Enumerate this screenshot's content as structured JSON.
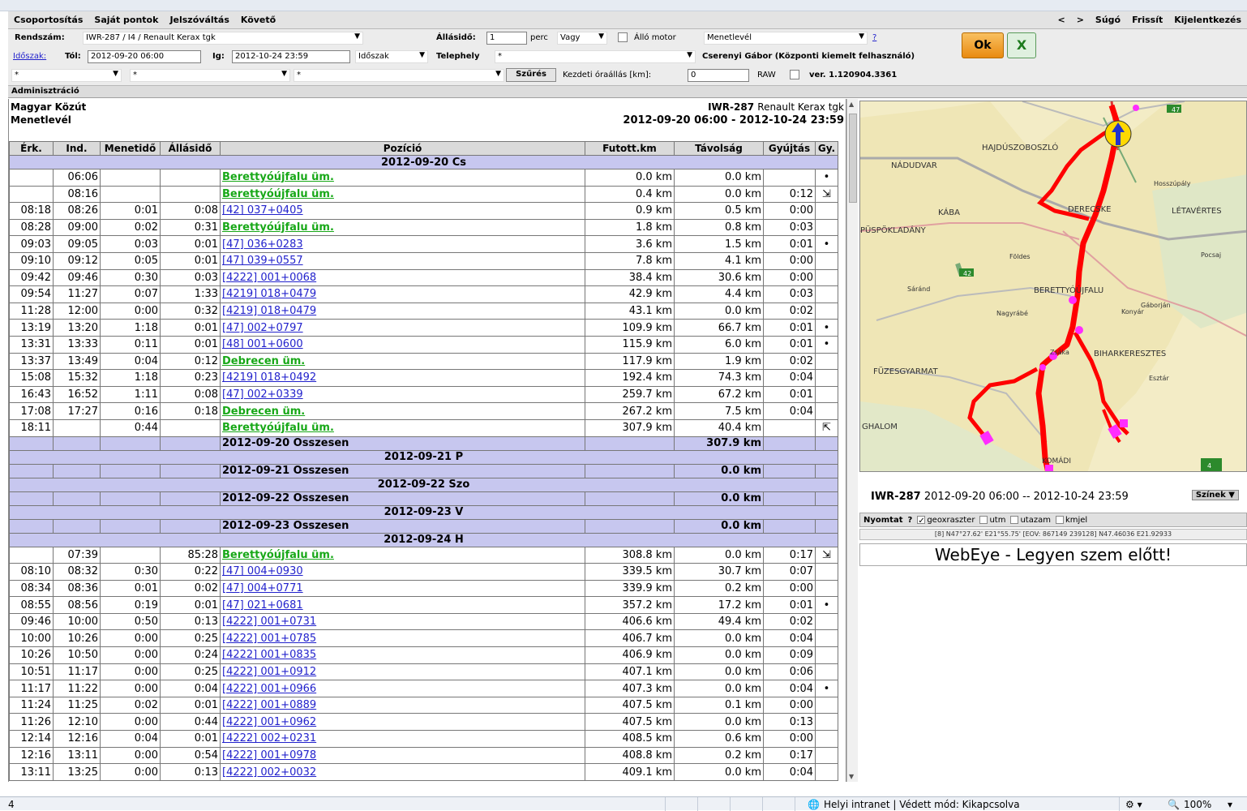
{
  "menu": {
    "items": [
      "Csoportosítás",
      "Saját pontok",
      "Jelszóváltás",
      "Követő"
    ],
    "right": [
      "<",
      ">",
      "Súgó",
      "Frissít",
      "Kijelentkezés"
    ]
  },
  "filter": {
    "rendszam_label": "Rendszám:",
    "rendszam_value": "IWR-287 / I4 / Renault Kerax tgk",
    "allasido_label": "Állásidő:",
    "allasido_value": "1",
    "perc": "perc",
    "vagy": "Vagy",
    "allo_motor": "Álló motor",
    "report_type": "Menetlevél",
    "help_q": "?",
    "idoszak_link": "Időszak:",
    "tol_label": "Tól:",
    "tol_value": "2012-09-20 06:00",
    "ig_label": "Ig:",
    "ig_value": "2012-10-24 23:59",
    "idoszak_combo": "Időszak",
    "telephely_label": "Telephely",
    "telephely_value": "*",
    "user": "Cserenyi Gábor (Központi kiemelt felhasználó)",
    "combo1": "*",
    "combo2": "*",
    "combo3": "*",
    "szures": "Szűrés",
    "kezdeti_label": "Kezdeti óraállás [km]:",
    "kezdeti_value": "0",
    "raw": "RAW",
    "version": "ver. 1.120904.3361",
    "ok": "Ok",
    "excel": "X"
  },
  "section": "Adminisztráció",
  "report": {
    "company": "Magyar Közút",
    "doc": "Menetlevél",
    "vehicle_id": "IWR-287",
    "vehicle_name": "Renault Kerax tgk",
    "period": "2012-09-20 06:00 - 2012-10-24 23:59",
    "columns": [
      "Érk.",
      "Ind.",
      "Menetidő",
      "Állásidő",
      "Pozíció",
      "Futott.km",
      "Távolság",
      "Gyújtás",
      "Gy."
    ],
    "rows": [
      {
        "t": "day",
        "label": "2012-09-20 Cs"
      },
      {
        "t": "r",
        "erk": "",
        "ind": "06:06",
        "menet": "",
        "allas": "",
        "pos": "Berettyóújfalu üm.",
        "g": true,
        "futott": "0.0 km",
        "tav": "0.0 km",
        "gyuj": "",
        "gy": "•"
      },
      {
        "t": "r",
        "erk": "",
        "ind": "08:16",
        "menet": "",
        "allas": "",
        "pos": "Berettyóújfalu üm.",
        "g": true,
        "futott": "0.4 km",
        "tav": "0.0 km",
        "gyuj": "0:12",
        "gy": "⇲"
      },
      {
        "t": "r",
        "erk": "08:18",
        "ind": "08:26",
        "menet": "0:01",
        "allas": "0:08",
        "pos": "[42] 037+0405",
        "g": false,
        "futott": "0.9 km",
        "tav": "0.5 km",
        "gyuj": "0:00",
        "gy": ""
      },
      {
        "t": "r",
        "erk": "08:28",
        "ind": "09:00",
        "menet": "0:02",
        "allas": "0:31",
        "pos": "Berettyóújfalu üm.",
        "g": true,
        "futott": "1.8 km",
        "tav": "0.8 km",
        "gyuj": "0:03",
        "gy": ""
      },
      {
        "t": "r",
        "erk": "09:03",
        "ind": "09:05",
        "menet": "0:03",
        "allas": "0:01",
        "pos": "[47] 036+0283",
        "g": false,
        "futott": "3.6 km",
        "tav": "1.5 km",
        "gyuj": "0:01",
        "gy": "•"
      },
      {
        "t": "r",
        "erk": "09:10",
        "ind": "09:12",
        "menet": "0:05",
        "allas": "0:01",
        "pos": "[47] 039+0557",
        "g": false,
        "futott": "7.8 km",
        "tav": "4.1 km",
        "gyuj": "0:00",
        "gy": ""
      },
      {
        "t": "r",
        "erk": "09:42",
        "ind": "09:46",
        "menet": "0:30",
        "allas": "0:03",
        "pos": "[4222] 001+0068",
        "g": false,
        "futott": "38.4 km",
        "tav": "30.6 km",
        "gyuj": "0:00",
        "gy": ""
      },
      {
        "t": "r",
        "erk": "09:54",
        "ind": "11:27",
        "menet": "0:07",
        "allas": "1:33",
        "pos": "[4219] 018+0479",
        "g": false,
        "futott": "42.9 km",
        "tav": "4.4 km",
        "gyuj": "0:03",
        "gy": ""
      },
      {
        "t": "r",
        "erk": "11:28",
        "ind": "12:00",
        "menet": "0:00",
        "allas": "0:32",
        "pos": "[4219] 018+0479",
        "g": false,
        "futott": "43.1 km",
        "tav": "0.0 km",
        "gyuj": "0:02",
        "gy": ""
      },
      {
        "t": "r",
        "erk": "13:19",
        "ind": "13:20",
        "menet": "1:18",
        "allas": "0:01",
        "pos": "[47] 002+0797",
        "g": false,
        "futott": "109.9 km",
        "tav": "66.7 km",
        "gyuj": "0:01",
        "gy": "•"
      },
      {
        "t": "r",
        "erk": "13:31",
        "ind": "13:33",
        "menet": "0:11",
        "allas": "0:01",
        "pos": "[48] 001+0600",
        "g": false,
        "futott": "115.9 km",
        "tav": "6.0 km",
        "gyuj": "0:01",
        "gy": "•"
      },
      {
        "t": "r",
        "erk": "13:37",
        "ind": "13:49",
        "menet": "0:04",
        "allas": "0:12",
        "pos": "Debrecen üm.",
        "g": true,
        "futott": "117.9 km",
        "tav": "1.9 km",
        "gyuj": "0:02",
        "gy": ""
      },
      {
        "t": "r",
        "erk": "15:08",
        "ind": "15:32",
        "menet": "1:18",
        "allas": "0:23",
        "pos": "[4219] 018+0492",
        "g": false,
        "futott": "192.4 km",
        "tav": "74.3 km",
        "gyuj": "0:04",
        "gy": ""
      },
      {
        "t": "r",
        "erk": "16:43",
        "ind": "16:52",
        "menet": "1:11",
        "allas": "0:08",
        "pos": "[47] 002+0339",
        "g": false,
        "futott": "259.7 km",
        "tav": "67.2 km",
        "gyuj": "0:01",
        "gy": ""
      },
      {
        "t": "r",
        "erk": "17:08",
        "ind": "17:27",
        "menet": "0:16",
        "allas": "0:18",
        "pos": "Debrecen üm.",
        "g": true,
        "futott": "267.2 km",
        "tav": "7.5 km",
        "gyuj": "0:04",
        "gy": ""
      },
      {
        "t": "r",
        "erk": "18:11",
        "ind": "",
        "menet": "0:44",
        "allas": "",
        "pos": "Berettyóújfalu üm.",
        "g": true,
        "futott": "307.9 km",
        "tav": "40.4 km",
        "gyuj": "",
        "gy": "⇱"
      },
      {
        "t": "sum",
        "label": "2012-09-20 Összesen",
        "total": "307.9 km"
      },
      {
        "t": "day",
        "label": "2012-09-21 P"
      },
      {
        "t": "sum",
        "label": "2012-09-21 Összesen",
        "total": "0.0 km"
      },
      {
        "t": "day",
        "label": "2012-09-22 Szo"
      },
      {
        "t": "sum",
        "label": "2012-09-22 Összesen",
        "total": "0.0 km"
      },
      {
        "t": "day",
        "label": "2012-09-23 V"
      },
      {
        "t": "sum",
        "label": "2012-09-23 Összesen",
        "total": "0.0 km"
      },
      {
        "t": "day",
        "label": "2012-09-24 H"
      },
      {
        "t": "r",
        "erk": "",
        "ind": "07:39",
        "menet": "",
        "allas": "85:28",
        "pos": "Berettyóújfalu üm.",
        "g": true,
        "futott": "308.8 km",
        "tav": "0.0 km",
        "gyuj": "0:17",
        "gy": "⇲"
      },
      {
        "t": "r",
        "erk": "08:10",
        "ind": "08:32",
        "menet": "0:30",
        "allas": "0:22",
        "pos": "[47] 004+0930",
        "g": false,
        "futott": "339.5 km",
        "tav": "30.7 km",
        "gyuj": "0:07",
        "gy": ""
      },
      {
        "t": "r",
        "erk": "08:34",
        "ind": "08:36",
        "menet": "0:01",
        "allas": "0:02",
        "pos": "[47] 004+0771",
        "g": false,
        "futott": "339.9 km",
        "tav": "0.2 km",
        "gyuj": "0:00",
        "gy": ""
      },
      {
        "t": "r",
        "erk": "08:55",
        "ind": "08:56",
        "menet": "0:19",
        "allas": "0:01",
        "pos": "[47] 021+0681",
        "g": false,
        "futott": "357.2 km",
        "tav": "17.2 km",
        "gyuj": "0:01",
        "gy": "•"
      },
      {
        "t": "r",
        "erk": "09:46",
        "ind": "10:00",
        "menet": "0:50",
        "allas": "0:13",
        "pos": "[4222] 001+0731",
        "g": false,
        "futott": "406.6 km",
        "tav": "49.4 km",
        "gyuj": "0:02",
        "gy": ""
      },
      {
        "t": "r",
        "erk": "10:00",
        "ind": "10:26",
        "menet": "0:00",
        "allas": "0:25",
        "pos": "[4222] 001+0785",
        "g": false,
        "futott": "406.7 km",
        "tav": "0.0 km",
        "gyuj": "0:04",
        "gy": ""
      },
      {
        "t": "r",
        "erk": "10:26",
        "ind": "10:50",
        "menet": "0:00",
        "allas": "0:24",
        "pos": "[4222] 001+0835",
        "g": false,
        "futott": "406.9 km",
        "tav": "0.0 km",
        "gyuj": "0:09",
        "gy": ""
      },
      {
        "t": "r",
        "erk": "10:51",
        "ind": "11:17",
        "menet": "0:00",
        "allas": "0:25",
        "pos": "[4222] 001+0912",
        "g": false,
        "futott": "407.1 km",
        "tav": "0.0 km",
        "gyuj": "0:06",
        "gy": ""
      },
      {
        "t": "r",
        "erk": "11:17",
        "ind": "11:22",
        "menet": "0:00",
        "allas": "0:04",
        "pos": "[4222] 001+0966",
        "g": false,
        "futott": "407.3 km",
        "tav": "0.0 km",
        "gyuj": "0:04",
        "gy": "•"
      },
      {
        "t": "r",
        "erk": "11:24",
        "ind": "11:25",
        "menet": "0:02",
        "allas": "0:01",
        "pos": "[4222] 001+0889",
        "g": false,
        "futott": "407.5 km",
        "tav": "0.1 km",
        "gyuj": "0:00",
        "gy": ""
      },
      {
        "t": "r",
        "erk": "11:26",
        "ind": "12:10",
        "menet": "0:00",
        "allas": "0:44",
        "pos": "[4222] 001+0962",
        "g": false,
        "futott": "407.5 km",
        "tav": "0.0 km",
        "gyuj": "0:13",
        "gy": ""
      },
      {
        "t": "r",
        "erk": "12:14",
        "ind": "12:16",
        "menet": "0:04",
        "allas": "0:01",
        "pos": "[4222] 002+0231",
        "g": false,
        "futott": "408.5 km",
        "tav": "0.6 km",
        "gyuj": "0:00",
        "gy": ""
      },
      {
        "t": "r",
        "erk": "12:16",
        "ind": "13:11",
        "menet": "0:00",
        "allas": "0:54",
        "pos": "[4222] 001+0978",
        "g": false,
        "futott": "408.8 km",
        "tav": "0.2 km",
        "gyuj": "0:17",
        "gy": ""
      },
      {
        "t": "r",
        "erk": "13:11",
        "ind": "13:25",
        "menet": "0:00",
        "allas": "0:13",
        "pos": "[4222] 002+0032",
        "g": false,
        "futott": "409.1 km",
        "tav": "0.0 km",
        "gyuj": "0:04",
        "gy": ""
      }
    ]
  },
  "map": {
    "places": [
      "HAJDÚSZOBOSZLÓ",
      "NÁDUDVAR",
      "KÁBA",
      "PÜSPÖKLADÁNY",
      "DERECSKE",
      "LÉTAVÉRTES",
      "BERETTYÓÚJFALU",
      "BIHARKERESZTES",
      "FÜZESGYARMAT",
      "GHALOM",
      "KOMÁDI",
      "Hosszúpály",
      "Pocsaj",
      "Földes",
      "Sáránd",
      "Nagyrábé",
      "Zsáka",
      "Konyár",
      "Gáborján",
      "Esztár"
    ],
    "road_labels": [
      "47",
      "42",
      "4"
    ],
    "info_vehicle": "IWR-287",
    "info_period": "2012-09-20 06:00 -- 2012-10-24 23:59",
    "szinek": "Színek",
    "tools": {
      "nyomtat": "Nyomtat",
      "q": "?",
      "geoxraszter": "geoxraszter",
      "utm": "utm",
      "utazam": "utazam",
      "kmjel": "kmjel"
    },
    "coords": "[8] N47°27.62' E21°55.75' [EOV: 867149 239128] N47.46036 E21.92933",
    "slogan": "WebEye - Legyen szem előtt!"
  },
  "status": {
    "left": "4",
    "zone": "Helyi intranet | Védett mód: Kikapcsolva",
    "zoom": "100%"
  }
}
